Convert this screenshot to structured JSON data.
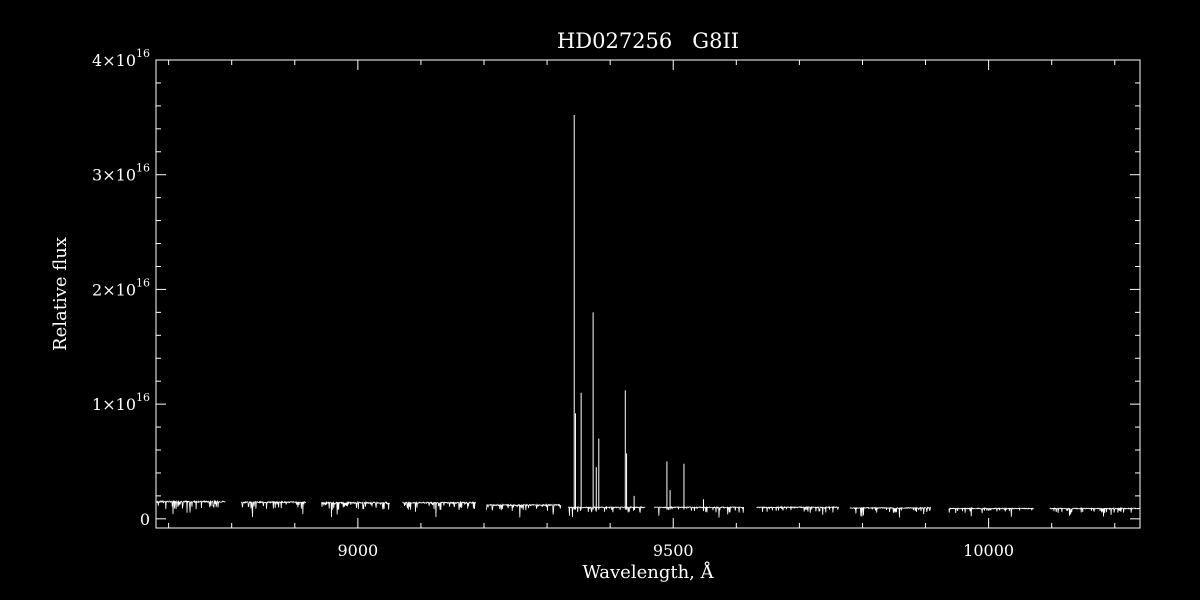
{
  "chart_data": {
    "type": "line",
    "title": "HD027256   G8II",
    "xlabel": "Wavelength, Å",
    "ylabel": "Relative flux",
    "xlim": [
      8680,
      10240
    ],
    "ylim": [
      -800000000000000.0,
      4e+16
    ],
    "x_ticks": [
      {
        "value": 9000,
        "label": "9000"
      },
      {
        "value": 9500,
        "label": "9500"
      },
      {
        "value": 10000,
        "label": "10000"
      }
    ],
    "y_ticks": [
      {
        "value": 0,
        "label": "0"
      },
      {
        "value": 1e+16,
        "label": "1×10",
        "exp": "16"
      },
      {
        "value": 2e+16,
        "label": "2×10",
        "exp": "16"
      },
      {
        "value": 3e+16,
        "label": "3×10",
        "exp": "16"
      },
      {
        "value": 4e+16,
        "label": "4×10",
        "exp": "16"
      }
    ],
    "grid": false,
    "legend": "none",
    "segments": [
      {
        "x_start": 8680,
        "x_end": 8790,
        "flux": 1500000000000000.0
      },
      {
        "x_start": 8815,
        "x_end": 8918,
        "flux": 1450000000000000.0
      },
      {
        "x_start": 8942,
        "x_end": 9051,
        "flux": 1400000000000000.0
      },
      {
        "x_start": 9071,
        "x_end": 9187,
        "flux": 1400000000000000.0
      },
      {
        "x_start": 9204,
        "x_end": 9322,
        "flux": 1200000000000000.0
      },
      {
        "x_start": 9333,
        "x_end": 9456,
        "flux": 1000000000000000.0
      },
      {
        "x_start": 9470,
        "x_end": 9612,
        "flux": 1000000000000000.0
      },
      {
        "x_start": 9632,
        "x_end": 9763,
        "flux": 1000000000000000.0
      },
      {
        "x_start": 9780,
        "x_end": 9909,
        "flux": 950000000000000.0
      },
      {
        "x_start": 9937,
        "x_end": 10072,
        "flux": 900000000000000.0
      },
      {
        "x_start": 10097,
        "x_end": 10240,
        "flux": 900000000000000.0
      }
    ],
    "spikes": [
      {
        "x": 9343,
        "y": 3.52e+16
      },
      {
        "x": 9345,
        "y": 9200000000000000.0
      },
      {
        "x": 9354,
        "y": 1.1e+16
      },
      {
        "x": 9373,
        "y": 1.8e+16
      },
      {
        "x": 9378,
        "y": 4500000000000000.0
      },
      {
        "x": 9382,
        "y": 7000000000000000.0
      },
      {
        "x": 9424,
        "y": 1.12e+16
      },
      {
        "x": 9426,
        "y": 5700000000000000.0
      },
      {
        "x": 9438,
        "y": 2000000000000000.0
      },
      {
        "x": 9490,
        "y": 5000000000000000.0
      },
      {
        "x": 9495,
        "y": 2500000000000000.0
      },
      {
        "x": 9517,
        "y": 4800000000000000.0
      },
      {
        "x": 9548,
        "y": 1700000000000000.0
      }
    ]
  }
}
